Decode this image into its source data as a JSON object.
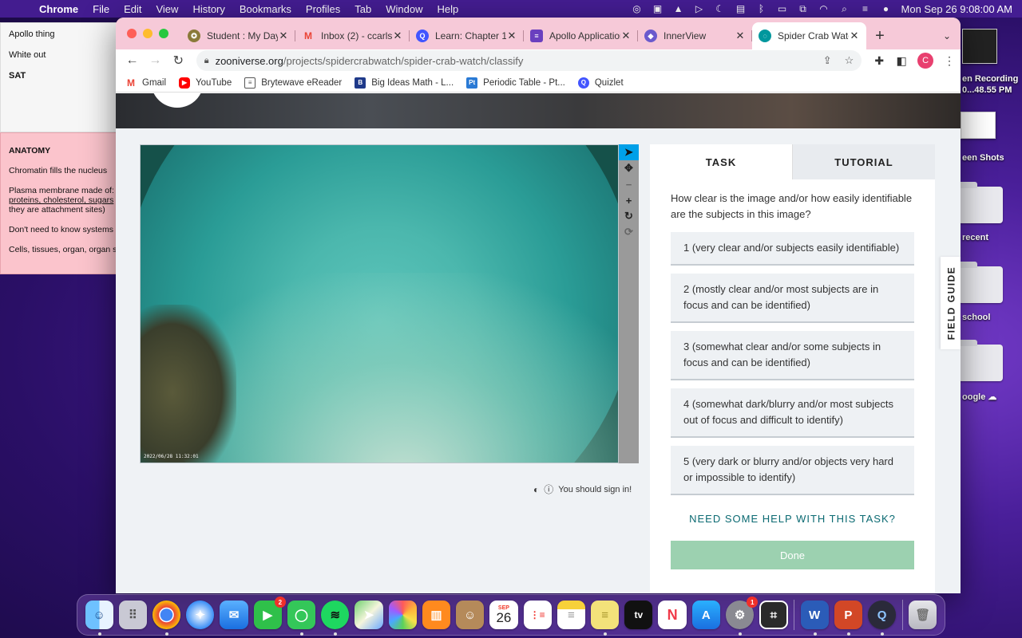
{
  "menubar": {
    "app_name": "Chrome",
    "menus": [
      "File",
      "Edit",
      "View",
      "History",
      "Bookmarks",
      "Profiles",
      "Tab",
      "Window",
      "Help"
    ],
    "datetime": "Mon Sep 26  9:08:00 AM"
  },
  "sticky_white": {
    "lines": [
      "Apollo thing",
      "White out",
      "SAT"
    ]
  },
  "sticky_pink": {
    "heading": "ANATOMY",
    "line1": "Chromatin fills the nucleus",
    "line2": "Plasma membrane made of:",
    "line3": "proteins, cholesterol, sugars",
    "line4": "they are attachment sites)",
    "line5": "Don't need to know systems",
    "line6": "Cells, tissues, organ, organ s"
  },
  "desktop": {
    "recording": "en Recording",
    "recording_time": "0...48.55 PM",
    "screenshots": "een Shots",
    "recent": "recent",
    "school": "school",
    "google": "oogle"
  },
  "tabs": [
    {
      "title": "Student : My Day",
      "favicon_color": "#8a7a3a",
      "favicon": "student-icon"
    },
    {
      "title": "Inbox (2) - ccarls",
      "favicon_color": "#ffffff",
      "favicon": "gmail-icon"
    },
    {
      "title": "Learn: Chapter 1",
      "favicon_color": "#4255ff",
      "favicon": "quizlet-icon"
    },
    {
      "title": "Apollo Application",
      "favicon_color": "#6a3fbf",
      "favicon": "form-icon"
    },
    {
      "title": "InnerView",
      "favicon_color": "#6a5acd",
      "favicon": "innerview-icon"
    },
    {
      "title": "Spider Crab Watc",
      "favicon_color": "#00979d",
      "favicon": "zooniverse-icon"
    }
  ],
  "url": {
    "host": "zooniverse.org",
    "path": "/projects/spidercrabwatch/spider-crab-watch/classify"
  },
  "profile_initial": "C",
  "bookmarks": [
    {
      "label": "Gmail",
      "color": "#ea4335",
      "icon": "gmail-icon"
    },
    {
      "label": "YouTube",
      "color": "#ff0000",
      "icon": "youtube-icon"
    },
    {
      "label": "Brytewave eReader",
      "color": "#555555",
      "icon": "book-icon"
    },
    {
      "label": "Big Ideas Math - L...",
      "color": "#1f3a8a",
      "icon": "bigideas-icon"
    },
    {
      "label": "Periodic Table - Pt...",
      "color": "#2a7ad5",
      "icon": "periodic-icon"
    },
    {
      "label": "Quizlet",
      "color": "#4255ff",
      "icon": "quizlet-icon"
    }
  ],
  "subject": {
    "timestamp": "2022/06/28 11:32:01"
  },
  "viewer_tools": [
    "pointer-icon",
    "move-icon",
    "zoom-out-icon",
    "zoom-in-icon",
    "rotate-icon",
    "reset-icon"
  ],
  "sign_in_text": "You should sign in!",
  "task_panel": {
    "tab_task": "TASK",
    "tab_tutorial": "TUTORIAL",
    "question": "How clear is the image and/or how easily identifiable are the subjects in this image?",
    "answers": [
      "1 (very clear and/or subjects easily identifiable)",
      "2 (mostly clear and/or most subjects are in focus and can be identified)",
      "3 (somewhat clear and/or some subjects in focus and can be identified)",
      "4 (somewhat dark/blurry and/or most subjects out of focus and difficult to identify)",
      "5 (very dark or blurry and/or objects very hard or impossible to identify)"
    ],
    "help_link": "NEED SOME HELP WITH THIS TASK?",
    "done_label": "Done"
  },
  "field_guide_label": "FIELD GUIDE",
  "dock": {
    "calendar_month": "SEP",
    "calendar_day": "26",
    "facetime_badge": "2",
    "settings_badge": "1",
    "tv_label": "tv",
    "word_label": "W",
    "powerpoint_label": "P"
  }
}
